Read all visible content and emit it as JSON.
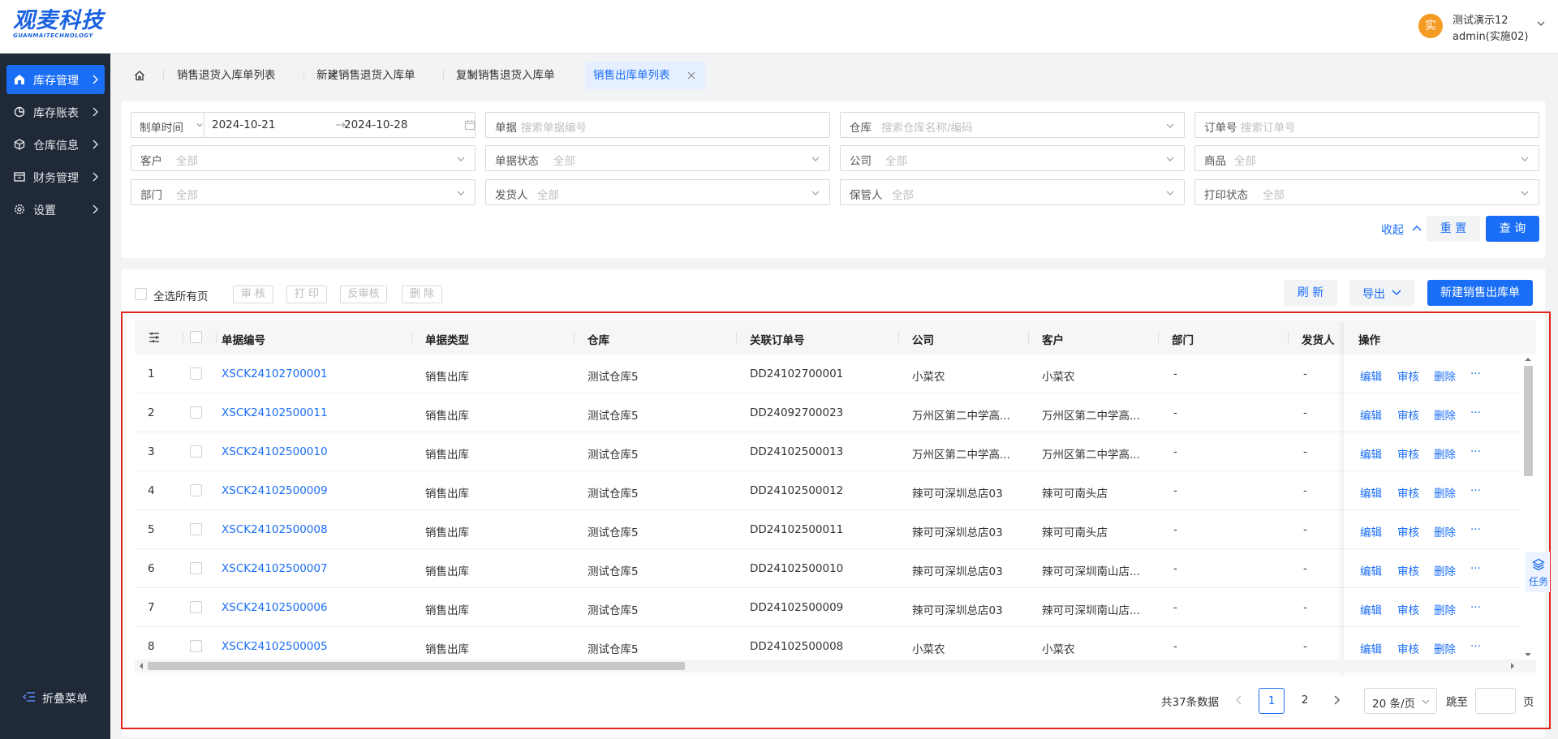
{
  "brand": {
    "name_cn": "观麦科技",
    "name_en": "GUANMAITECHNOLOGY",
    "color": "#1a63e0"
  },
  "user": {
    "avatar_text": "实",
    "name": "测试演示12",
    "role": "admin(实施02)"
  },
  "sidebar": {
    "items": [
      {
        "label": "库存管理",
        "icon": "warehouse-home-icon",
        "active": true
      },
      {
        "label": "库存账表",
        "icon": "chart-pie-icon",
        "active": false
      },
      {
        "label": "仓库信息",
        "icon": "cube-icon",
        "active": false
      },
      {
        "label": "财务管理",
        "icon": "wallet-icon",
        "active": false
      },
      {
        "label": "设置",
        "icon": "gear-icon",
        "active": false
      }
    ],
    "collapse_label": "折叠菜单"
  },
  "tabs": [
    {
      "label": "销售退货入库单列表",
      "active": false
    },
    {
      "label": "新建销售退货入库单",
      "active": false
    },
    {
      "label": "复制销售退货入库单",
      "active": false
    },
    {
      "label": "销售出库单列表",
      "active": true
    }
  ],
  "filters": {
    "date": {
      "label": "制单时间",
      "start": "2024-10-21",
      "end": "2024-10-28"
    },
    "doc": {
      "label": "单据",
      "placeholder": "搜索单据编号"
    },
    "warehouse": {
      "label": "仓库",
      "placeholder": "搜索仓库名称/编码"
    },
    "order": {
      "label": "订单号",
      "placeholder": "搜索订单号"
    },
    "customer": {
      "label": "客户",
      "value": "全部"
    },
    "doc_status": {
      "label": "单据状态",
      "value": "全部"
    },
    "company": {
      "label": "公司",
      "value": "全部"
    },
    "product": {
      "label": "商品",
      "value": "全部"
    },
    "department": {
      "label": "部门",
      "value": "全部"
    },
    "shipper": {
      "label": "发货人",
      "value": "全部"
    },
    "keeper": {
      "label": "保管人",
      "value": "全部"
    },
    "print_status": {
      "label": "打印状态",
      "value": "全部"
    },
    "collapse_label": "收起",
    "reset_label": "重 置",
    "query_label": "查 询"
  },
  "toolbar": {
    "select_all_label": "全选所有页",
    "approve": "审 核",
    "print": "打 印",
    "unapprove": "反审核",
    "delete": "删 除",
    "refresh": "刷 新",
    "export": "导出",
    "new": "新建销售出库单"
  },
  "table": {
    "columns": [
      "单据编号",
      "单据类型",
      "仓库",
      "关联订单号",
      "公司",
      "客户",
      "部门",
      "发货人",
      "操作"
    ],
    "actions": {
      "edit": "编辑",
      "approve": "审核",
      "delete": "删除",
      "more": "···"
    },
    "rows": [
      {
        "index": "1",
        "code": "XSCK24102700001",
        "type": "销售出库",
        "warehouse": "测试仓库5",
        "order": "DD24102700001",
        "company": "小菜农",
        "customer": "小菜农",
        "dept": "-",
        "shipper": "-"
      },
      {
        "index": "2",
        "code": "XSCK24102500011",
        "type": "销售出库",
        "warehouse": "测试仓库5",
        "order": "DD24092700023",
        "company": "万州区第二中学高...",
        "customer": "万州区第二中学高...",
        "dept": "-",
        "shipper": "-"
      },
      {
        "index": "3",
        "code": "XSCK24102500010",
        "type": "销售出库",
        "warehouse": "测试仓库5",
        "order": "DD24102500013",
        "company": "万州区第二中学高...",
        "customer": "万州区第二中学高...",
        "dept": "-",
        "shipper": "-"
      },
      {
        "index": "4",
        "code": "XSCK24102500009",
        "type": "销售出库",
        "warehouse": "测试仓库5",
        "order": "DD24102500012",
        "company": "辣可可深圳总店03",
        "customer": "辣可可南头店",
        "dept": "-",
        "shipper": "-"
      },
      {
        "index": "5",
        "code": "XSCK24102500008",
        "type": "销售出库",
        "warehouse": "测试仓库5",
        "order": "DD24102500011",
        "company": "辣可可深圳总店03",
        "customer": "辣可可南头店",
        "dept": "-",
        "shipper": "-"
      },
      {
        "index": "6",
        "code": "XSCK24102500007",
        "type": "销售出库",
        "warehouse": "测试仓库5",
        "order": "DD24102500010",
        "company": "辣可可深圳总店03",
        "customer": "辣可可深圳南山店...",
        "dept": "-",
        "shipper": "-"
      },
      {
        "index": "7",
        "code": "XSCK24102500006",
        "type": "销售出库",
        "warehouse": "测试仓库5",
        "order": "DD24102500009",
        "company": "辣可可深圳总店03",
        "customer": "辣可可深圳南山店...",
        "dept": "-",
        "shipper": "-"
      },
      {
        "index": "8",
        "code": "XSCK24102500005",
        "type": "销售出库",
        "warehouse": "测试仓库5",
        "order": "DD24102500008",
        "company": "小菜农",
        "customer": "小菜农",
        "dept": "-",
        "shipper": "-"
      }
    ]
  },
  "pager": {
    "total": "共37条数据",
    "pages": [
      "1",
      "2"
    ],
    "current": "1",
    "page_size": "20 条/页",
    "goto_label": "跳至",
    "page_label": "页"
  },
  "task_float": {
    "label": "任务"
  },
  "colors": {
    "primary": "#1a6ef5",
    "sidebar_bg": "#1f2937",
    "highlight_frame": "#e5221b",
    "avatar_bg": "#f59a23"
  }
}
